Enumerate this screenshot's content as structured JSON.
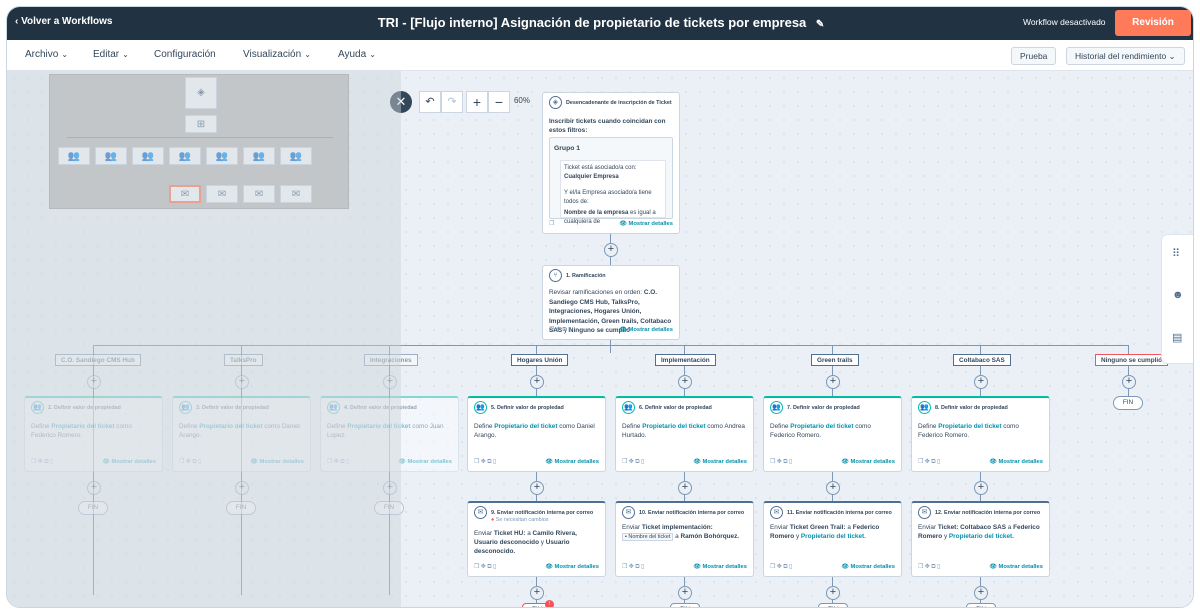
{
  "topbar": {
    "back_label": "Volver a Workflows",
    "title": "TRI - [Flujo interno] Asignación de propietario de tickets por empresa",
    "status": "Workflow desactivado",
    "review_button": "Revisión"
  },
  "menu": {
    "items": [
      "Archivo",
      "Editar",
      "Configuración",
      "Visualización",
      "Ayuda"
    ],
    "test_button": "Prueba",
    "history_button": "Historial del rendimiento"
  },
  "toolbar": {
    "zoom": "60%"
  },
  "trigger": {
    "title": "Desencadenante de inscripción de Ticket",
    "intro": "Inscribir tickets cuando coincidan con estos filtros:",
    "group_title": "Grupo 1",
    "line1": "Ticket está asociado/a con:",
    "line1_bold": "Cualquier Empresa",
    "line2": "Y el/la Empresa asociado/a tiene todos de:",
    "line3_bold": "Nombre de la empresa",
    "line3": "es igual a cualquiera de",
    "show_details": "Mostrar detalles"
  },
  "branch": {
    "title": "1. Ramificación",
    "text": "Revisar ramificaciones en orden:",
    "branches_bold": "C.O. Sandiego CMS Hub, TalksPro, Integraciones, Hogares Unión, Implementación, Green trails, Coltabaco SAS",
    "connector": "y",
    "last_bold": "Ninguno se cumplió",
    "show_details": "Mostrar detalles"
  },
  "branch_labels": [
    "C.O. Sandiego CMS Hub",
    "TalksPro",
    "Integraciones",
    "Hogares Unión",
    "Implementación",
    "Green trails",
    "Coltabaco SAS",
    "Ninguno se cumplió"
  ],
  "set_cards": [
    {
      "title": "2. Definir valor de propiedad",
      "define": "Define",
      "prop": "Propietario del ticket",
      "como": "como",
      "value": "Federico Romero."
    },
    {
      "title": "3. Definir valor de propiedad",
      "define": "Define",
      "prop": "Propietario del ticket",
      "como": "como",
      "value": "Daniel Arango."
    },
    {
      "title": "4. Definir valor de propiedad",
      "define": "Define",
      "prop": "Propietario del ticket",
      "como": "como",
      "value": "Juan Lopez."
    },
    {
      "title": "5. Definir valor de propiedad",
      "define": "Define",
      "prop": "Propietario del ticket",
      "como": "como",
      "value": "Daniel Arango."
    },
    {
      "title": "6. Definir valor de propiedad",
      "define": "Define",
      "prop": "Propietario del ticket",
      "como": "como",
      "value": "Andrea Hurtado."
    },
    {
      "title": "7. Definir valor de propiedad",
      "define": "Define",
      "prop": "Propietario del ticket",
      "como": "como",
      "value": "Federico Romero."
    },
    {
      "title": "8. Definir valor de propiedad",
      "define": "Define",
      "prop": "Propietario del ticket",
      "como": "como",
      "value": "Federico Romero."
    }
  ],
  "show_details": "Mostrar detalles",
  "fin_label": "FIN",
  "email_cards": [
    {
      "title": "9. Enviar notificación interna por correo",
      "warning": "Se necesitan cambios",
      "text_a": "Enviar",
      "bold_a": "Ticket HU:",
      "text_b": "a",
      "bold_b": "Camilo Rivera, Usuario desconocido",
      "text_c": "y",
      "bold_c": "Usuario desconocido."
    },
    {
      "title": "10. Enviar notificación interna por correo",
      "text_a": "Enviar",
      "bold_a": "Ticket implementación:",
      "token": "Nombre del ticket",
      "text_b": "a",
      "bold_b": "Ramón Bohórquez."
    },
    {
      "title": "11. Enviar notificación interna por correo",
      "text_a": "Enviar",
      "bold_a": "Ticket Green Trail:",
      "text_b": "a",
      "bold_b": "Federico Romero",
      "text_c": "y",
      "link_c": "Propietario del ticket."
    },
    {
      "title": "12. Enviar notificación interna por correo",
      "text_a": "Enviar",
      "bold_a": "Ticket: Coltabaco SAS",
      "text_b": "a",
      "bold_b": "Federico Romero",
      "text_c": "y",
      "link_c": "Propietario del ticket."
    }
  ],
  "error_badge": "!"
}
